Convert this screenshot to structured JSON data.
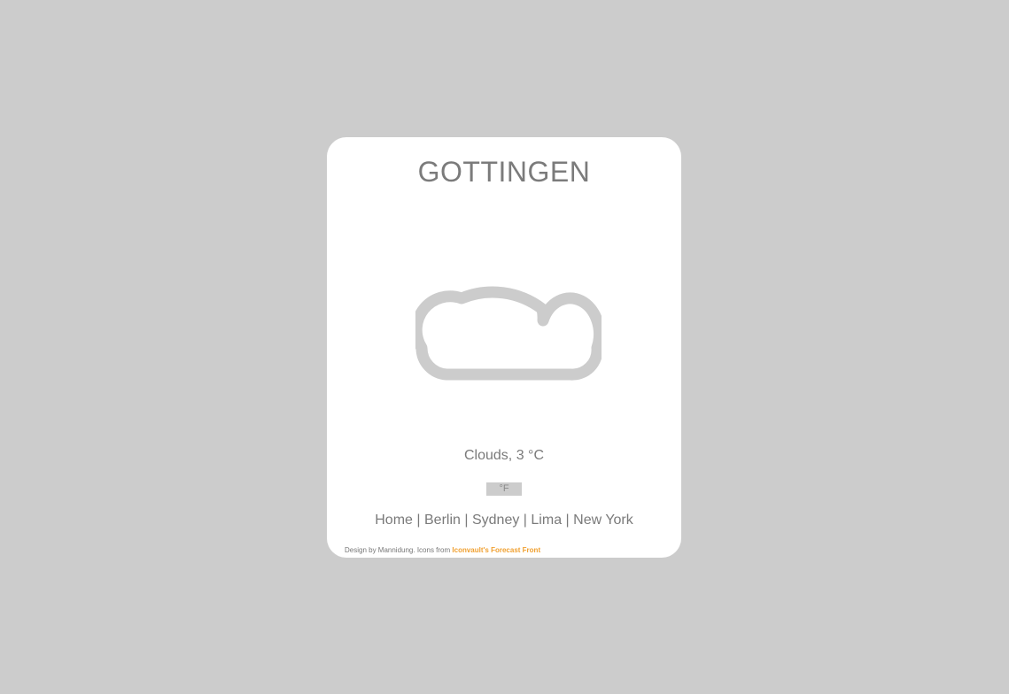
{
  "city": "GOTTINGEN",
  "weather": {
    "icon": "cloud-icon",
    "condition_text": "Clouds, 3 °C"
  },
  "unit_toggle": {
    "label": "°F"
  },
  "nav": {
    "links": [
      "Home",
      "Berlin",
      "Sydney",
      "Lima",
      "New York"
    ],
    "separator": "|"
  },
  "credit": {
    "text": "Design by Mannidung. Icons from",
    "link_text": "Iconvault's Forecast Front"
  },
  "colors": {
    "page_background": "#cccccc",
    "card_background": "#ffffff",
    "text": "#7a7a7a",
    "icon_stroke": "#cccccc",
    "credit_link": "#f0a030"
  }
}
